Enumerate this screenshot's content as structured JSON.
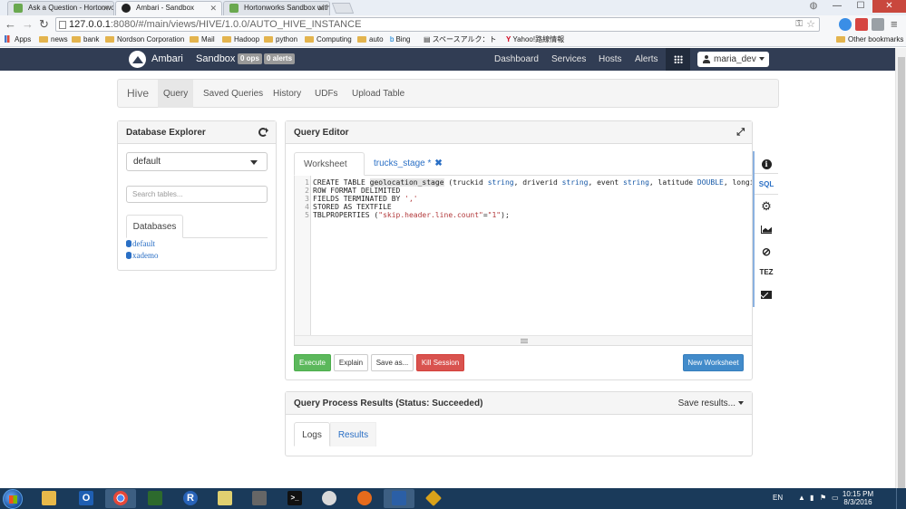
{
  "browser": {
    "tabs": [
      {
        "title": "Ask a Question - Hortonworks",
        "active": false,
        "favicon_color": "#6aa84f"
      },
      {
        "title": "Ambari - Sandbox",
        "active": true,
        "favicon_color": "#222222"
      },
      {
        "title": "Hortonworks Sandbox with",
        "active": false,
        "favicon_color": "#6aa84f"
      }
    ],
    "url_host": "127.0.0.1",
    "url_path": ":8080/#/main/views/HIVE/1.0.0/AUTO_HIVE_INSTANCE",
    "bookmarks": [
      {
        "label": "Apps",
        "type": "apps"
      },
      {
        "label": "news",
        "type": "folder"
      },
      {
        "label": "bank",
        "type": "folder"
      },
      {
        "label": "Nordson Corporation",
        "type": "folder"
      },
      {
        "label": "Mail",
        "type": "folder"
      },
      {
        "label": "Hadoop",
        "type": "folder"
      },
      {
        "label": "python",
        "type": "folder"
      },
      {
        "label": "Computing",
        "type": "folder"
      },
      {
        "label": "auto",
        "type": "folder"
      },
      {
        "label": "Bing",
        "type": "link"
      },
      {
        "label": "スペースアルク：ト",
        "type": "link"
      },
      {
        "label": "Yahoo!路線情報",
        "type": "link"
      }
    ],
    "other_bookmarks": "Other bookmarks"
  },
  "ambari": {
    "brand": "Ambari",
    "cluster": "Sandbox",
    "ops_badge": "0 ops",
    "alerts_badge": "0 alerts",
    "nav": [
      "Dashboard",
      "Services",
      "Hosts",
      "Alerts"
    ],
    "user": "maria_dev"
  },
  "hive": {
    "brand": "Hive",
    "tabs": [
      "Query",
      "Saved Queries",
      "History",
      "UDFs",
      "Upload Table"
    ],
    "active_tab": "Query"
  },
  "db_explorer": {
    "title": "Database Explorer",
    "selected_db": "default",
    "search_placeholder": "Search tables...",
    "tab": "Databases",
    "databases": [
      "default",
      "xademo"
    ]
  },
  "query_editor": {
    "title": "Query Editor",
    "worksheets": [
      {
        "label": "Worksheet *",
        "active": true
      },
      {
        "label": "trucks_stage *",
        "active": false
      }
    ],
    "code_lines": [
      "CREATE TABLE geolocation_stage (truckid string, driverid string, event string, latitude DOUBLE, longi",
      "ROW FORMAT DELIMITED",
      "FIELDS TERMINATED BY ','",
      "STORED AS TEXTFILE",
      "TBLPROPERTIES (\"skip.header.line.count\"=\"1\");"
    ],
    "buttons": {
      "execute": "Execute",
      "explain": "Explain",
      "save_as": "Save as...",
      "kill": "Kill Session",
      "new_worksheet": "New Worksheet"
    },
    "side_tools": [
      "info-icon",
      "SQL",
      "gear-icon",
      "chart-icon",
      "link-icon",
      "TEZ",
      "envelope-icon"
    ]
  },
  "results": {
    "title": "Query Process Results (Status: Succeeded)",
    "save_results": "Save results...",
    "tabs": [
      "Logs",
      "Results"
    ]
  },
  "taskbar": {
    "apps": [
      {
        "name": "explorer-icon",
        "color": "#e8b94a",
        "glyph": ""
      },
      {
        "name": "outlook-icon",
        "color": "#1f5fb3",
        "glyph": "O"
      },
      {
        "name": "chrome-icon",
        "color": "#3c7d3c",
        "glyph": ""
      },
      {
        "name": "terminal-green-icon",
        "color": "#2d6a2d",
        "glyph": ""
      },
      {
        "name": "r-icon",
        "color": "#2863b8",
        "glyph": "R"
      },
      {
        "name": "editor-icon",
        "color": "#e0d070",
        "glyph": ""
      },
      {
        "name": "tools-icon",
        "color": "#666666",
        "glyph": ""
      },
      {
        "name": "cmd-icon",
        "color": "#111111",
        "glyph": ">_"
      },
      {
        "name": "clock-app-icon",
        "color": "#d9d9d9",
        "glyph": ""
      },
      {
        "name": "firefox-icon",
        "color": "#e66b1c",
        "glyph": ""
      },
      {
        "name": "virtualbox-icon",
        "color": "#2b5fa6",
        "glyph": ""
      },
      {
        "name": "git-icon",
        "color": "#d9a21a",
        "glyph": ""
      }
    ],
    "language": "EN",
    "time": "10:15 PM",
    "date": "8/3/2016"
  }
}
